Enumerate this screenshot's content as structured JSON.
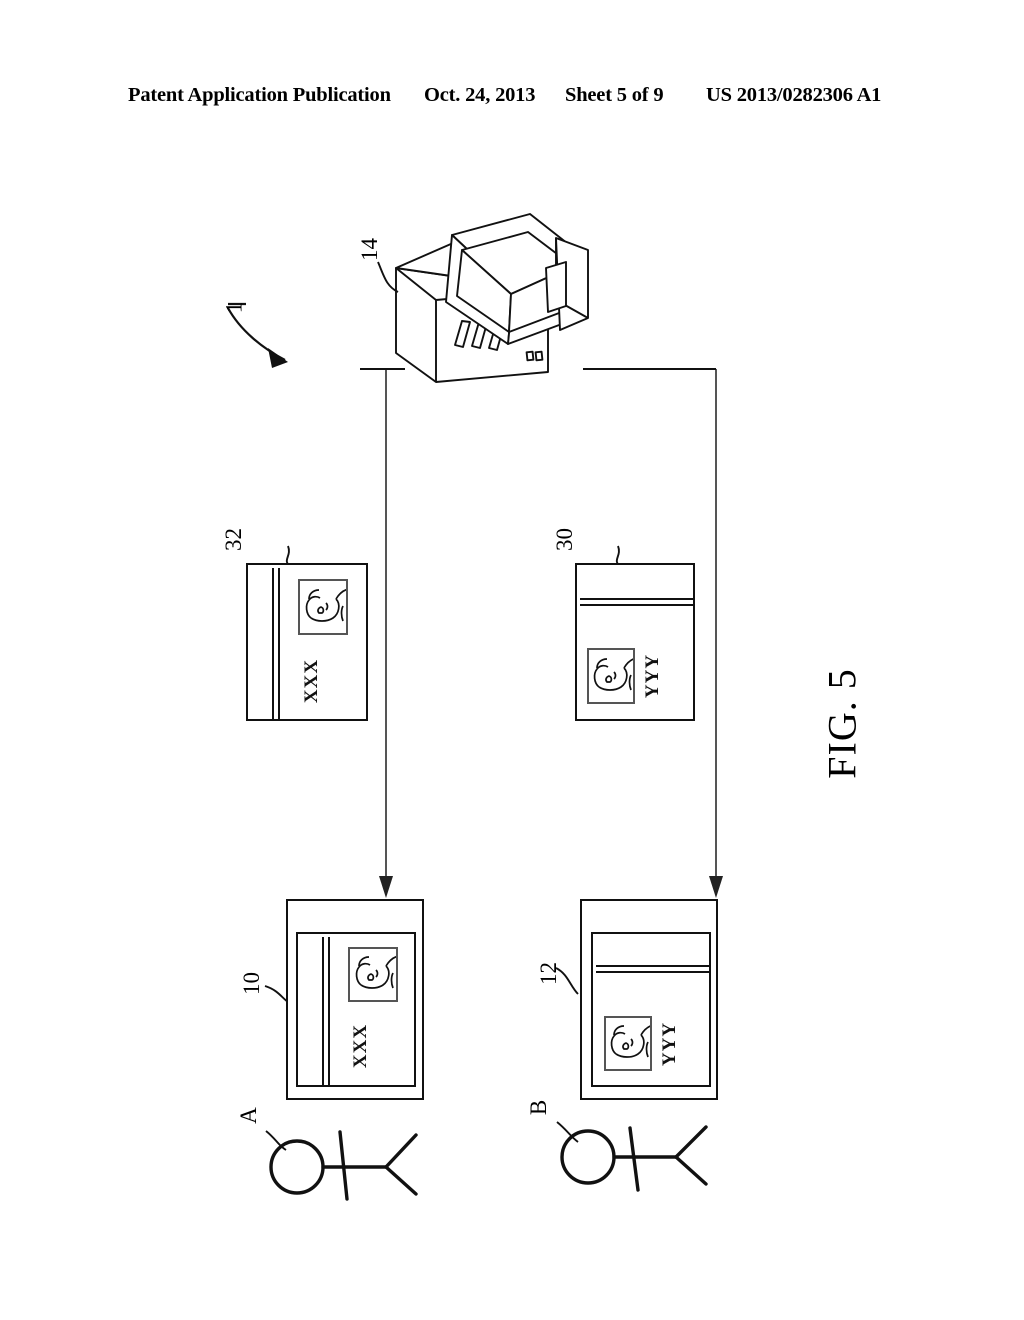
{
  "header": {
    "left": "Patent Application Publication",
    "date": "Oct. 24, 2013",
    "sheet": "Sheet 5 of 9",
    "number": "US 2013/0282306 A1"
  },
  "figure": {
    "caption": "FIG. 5",
    "system_ref": "1"
  },
  "nodes": {
    "server": {
      "ref": "14",
      "name": "computer-server"
    },
    "card_xxx_source": {
      "ref": "32",
      "text": "XXX",
      "photo": "face-portrait"
    },
    "card_yyy_source": {
      "ref": "30",
      "text": "YYY",
      "photo": "face-portrait"
    },
    "device_a": {
      "ref": "10",
      "text": "XXX",
      "photo": "face-portrait"
    },
    "device_b": {
      "ref": "12",
      "text": "YYY",
      "photo": "face-portrait"
    }
  },
  "actors": {
    "user_a": {
      "ref": "A"
    },
    "user_b": {
      "ref": "B"
    }
  }
}
